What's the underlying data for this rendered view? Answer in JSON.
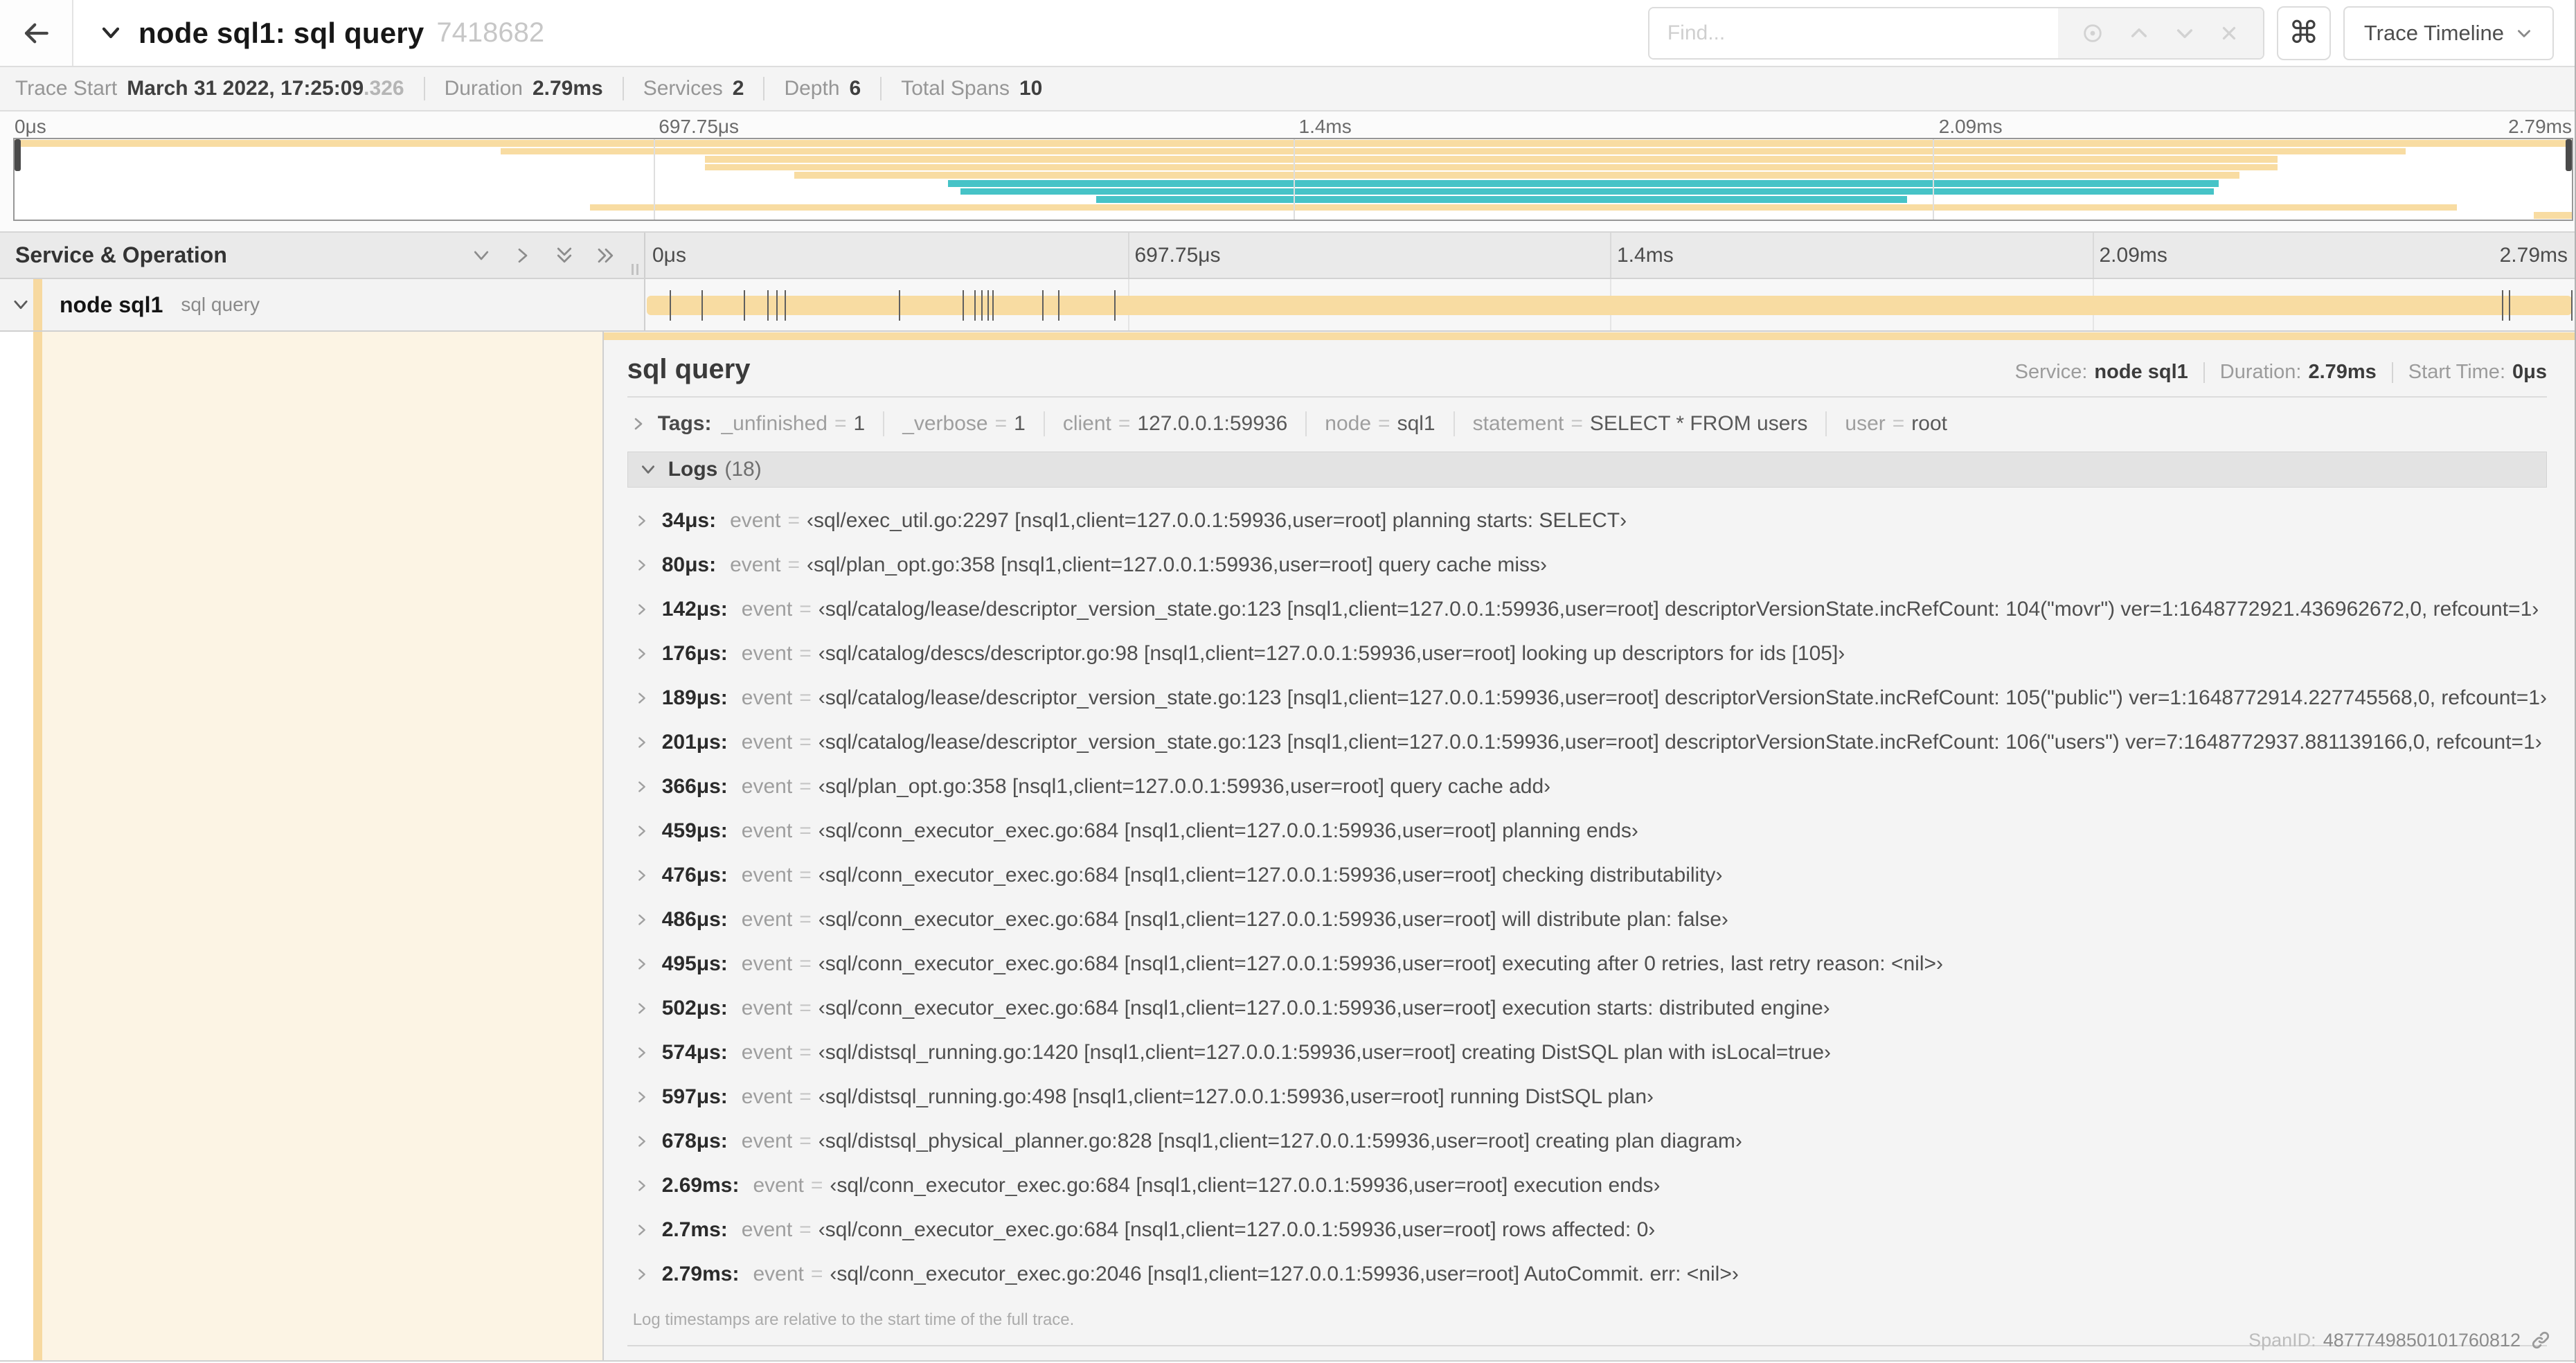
{
  "colors": {
    "tan": "#f8dca2",
    "teal": "#46c3c7",
    "accent": "#f7d9a0",
    "cream": "#fcf4e4"
  },
  "header": {
    "title": "node sql1: sql query",
    "trace_id": "7418682",
    "find_placeholder": "Find...",
    "cmd_label": "⌘",
    "view_selector": "Trace Timeline",
    "find_icons": [
      "target-icon",
      "chevron-up-icon",
      "chevron-down-icon",
      "clear-icon"
    ]
  },
  "infobar": {
    "items": [
      {
        "label": "Trace Start",
        "value": "March 31 2022, 17:25:09",
        "suffix": ".326"
      },
      {
        "label": "Duration",
        "value": "2.79ms"
      },
      {
        "label": "Services",
        "value": "2"
      },
      {
        "label": "Depth",
        "value": "6"
      },
      {
        "label": "Total Spans",
        "value": "10"
      }
    ]
  },
  "timeline": {
    "left_header": "Service & Operation",
    "ticks": [
      "0μs",
      "697.75μs",
      "1.4ms",
      "2.09ms",
      "2.79ms"
    ],
    "duration_us": 2790
  },
  "minimap": {
    "spans": [
      {
        "start": 0.0,
        "end": 1.0,
        "color": "tan"
      },
      {
        "start": 0.19,
        "end": 0.935,
        "color": "tan"
      },
      {
        "start": 0.27,
        "end": 0.885,
        "color": "tan"
      },
      {
        "start": 0.27,
        "end": 0.885,
        "color": "tan"
      },
      {
        "start": 0.305,
        "end": 0.87,
        "color": "tan"
      },
      {
        "start": 0.365,
        "end": 0.862,
        "color": "teal"
      },
      {
        "start": 0.37,
        "end": 0.86,
        "color": "teal"
      },
      {
        "start": 0.423,
        "end": 0.74,
        "color": "teal"
      },
      {
        "start": 0.225,
        "end": 0.955,
        "color": "tan"
      },
      {
        "start": 0.985,
        "end": 1.0,
        "color": "tan"
      }
    ]
  },
  "span_row": {
    "service": "node sql1",
    "operation": "sql query"
  },
  "detail": {
    "title": "sql query",
    "meta": [
      {
        "label": "Service:",
        "value": "node sql1"
      },
      {
        "label": "Duration:",
        "value": "2.79ms"
      },
      {
        "label": "Start Time:",
        "value": "0μs"
      }
    ],
    "tags_label": "Tags:",
    "tags": [
      {
        "key": "_unfinished",
        "value": "1"
      },
      {
        "key": "_verbose",
        "value": "1"
      },
      {
        "key": "client",
        "value": "127.0.0.1:59936"
      },
      {
        "key": "node",
        "value": "sql1"
      },
      {
        "key": "statement",
        "value": "SELECT * FROM users"
      },
      {
        "key": "user",
        "value": "root"
      }
    ],
    "logs_label": "Logs",
    "logs_count": "(18)",
    "log_key": "event",
    "eq": "=",
    "logs": [
      {
        "time": "34μs:",
        "t_us": 34,
        "value": "‹sql/exec_util.go:2297 [nsql1,client=127.0.0.1:59936,user=root] planning starts: SELECT›"
      },
      {
        "time": "80μs:",
        "t_us": 80,
        "value": "‹sql/plan_opt.go:358 [nsql1,client=127.0.0.1:59936,user=root] query cache miss›"
      },
      {
        "time": "142μs:",
        "t_us": 142,
        "value": "‹sql/catalog/lease/descriptor_version_state.go:123 [nsql1,client=127.0.0.1:59936,user=root] descriptorVersionState.incRefCount: 104(\"movr\") ver=1:1648772921.436962672,0, refcount=1›"
      },
      {
        "time": "176μs:",
        "t_us": 176,
        "value": "‹sql/catalog/descs/descriptor.go:98 [nsql1,client=127.0.0.1:59936,user=root] looking up descriptors for ids [105]›"
      },
      {
        "time": "189μs:",
        "t_us": 189,
        "value": "‹sql/catalog/lease/descriptor_version_state.go:123 [nsql1,client=127.0.0.1:59936,user=root] descriptorVersionState.incRefCount: 105(\"public\") ver=1:1648772914.227745568,0, refcount=1›"
      },
      {
        "time": "201μs:",
        "t_us": 201,
        "value": "‹sql/catalog/lease/descriptor_version_state.go:123 [nsql1,client=127.0.0.1:59936,user=root] descriptorVersionState.incRefCount: 106(\"users\") ver=7:1648772937.881139166,0, refcount=1›"
      },
      {
        "time": "366μs:",
        "t_us": 366,
        "value": "‹sql/plan_opt.go:358 [nsql1,client=127.0.0.1:59936,user=root] query cache add›"
      },
      {
        "time": "459μs:",
        "t_us": 459,
        "value": "‹sql/conn_executor_exec.go:684 [nsql1,client=127.0.0.1:59936,user=root] planning ends›"
      },
      {
        "time": "476μs:",
        "t_us": 476,
        "value": "‹sql/conn_executor_exec.go:684 [nsql1,client=127.0.0.1:59936,user=root] checking distributability›"
      },
      {
        "time": "486μs:",
        "t_us": 486,
        "value": "‹sql/conn_executor_exec.go:684 [nsql1,client=127.0.0.1:59936,user=root] will distribute plan: false›"
      },
      {
        "time": "495μs:",
        "t_us": 495,
        "value": "‹sql/conn_executor_exec.go:684 [nsql1,client=127.0.0.1:59936,user=root] executing after 0 retries, last retry reason: <nil>›"
      },
      {
        "time": "502μs:",
        "t_us": 502,
        "value": "‹sql/conn_executor_exec.go:684 [nsql1,client=127.0.0.1:59936,user=root] execution starts: distributed engine›"
      },
      {
        "time": "574μs:",
        "t_us": 574,
        "value": "‹sql/distsql_running.go:1420 [nsql1,client=127.0.0.1:59936,user=root] creating DistSQL plan with isLocal=true›"
      },
      {
        "time": "597μs:",
        "t_us": 597,
        "value": "‹sql/distsql_running.go:498 [nsql1,client=127.0.0.1:59936,user=root] running DistSQL plan›"
      },
      {
        "time": "678μs:",
        "t_us": 678,
        "value": "‹sql/distsql_physical_planner.go:828 [nsql1,client=127.0.0.1:59936,user=root] creating plan diagram›"
      },
      {
        "time": "2.69ms:",
        "t_us": 2690,
        "value": "‹sql/conn_executor_exec.go:684 [nsql1,client=127.0.0.1:59936,user=root] execution ends›"
      },
      {
        "time": "2.7ms:",
        "t_us": 2700,
        "value": "‹sql/conn_executor_exec.go:684 [nsql1,client=127.0.0.1:59936,user=root] rows affected: 0›"
      },
      {
        "time": "2.79ms:",
        "t_us": 2790,
        "value": "‹sql/conn_executor_exec.go:2046 [nsql1,client=127.0.0.1:59936,user=root] AutoCommit. err: <nil>›"
      }
    ],
    "note": "Log timestamps are relative to the start time of the full trace.",
    "footer_label": "SpanID:",
    "span_id": "4877749850101760812"
  }
}
